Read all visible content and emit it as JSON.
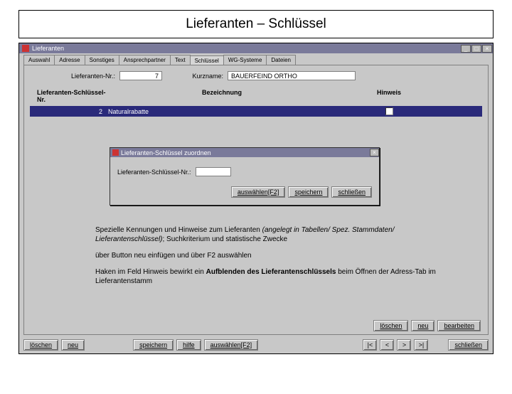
{
  "slide_title": "Lieferanten – Schlüssel",
  "window": {
    "title": "Lieferanten",
    "min": "_",
    "max": "□",
    "close": "×"
  },
  "tabs": [
    "Auswahl",
    "Adresse",
    "Sonstiges",
    "Ansprechpartner",
    "Text",
    "Schlüssel",
    "WG-Systeme",
    "Dateien"
  ],
  "header": {
    "lief_nr_label": "Lieferanten-Nr.:",
    "lief_nr_value": "7",
    "kurz_label": "Kurzname:",
    "kurz_value": "BAUERFEIND ORTHO"
  },
  "columns": {
    "c1": "Lieferanten-Schlüssel-Nr.",
    "c2": "Bezeichnung",
    "c3": "Hinweis"
  },
  "row": {
    "nr": "2",
    "bez": "Naturalrabatte",
    "hinweis_checked": true
  },
  "dialog": {
    "title": "Lieferanten-Schlüssel zuordnen",
    "field_label": "Lieferanten-Schlüssel-Nr.:",
    "field_value": "",
    "btn_auswaehlen": "auswählen[F2]",
    "btn_speichern": "speichern",
    "btn_schliessen": "schließen",
    "close": "×"
  },
  "info": {
    "p1a": "Spezielle Kennungen und Hinweise zum Lieferanten ",
    "p1b": "(angelegt in Tabellen/ Spez. Stammdaten/ Lieferantenschlüssel)",
    "p1c": "; Suchkriterium und statistische Zwecke",
    "p2": "über Button neu einfügen und über F2 auswählen",
    "p3a": "Haken im Feld Hinweis bewirkt ein ",
    "p3b": "Aufblenden des Lieferantenschlüssels",
    "p3c": " beim Öffnen der Adress-Tab im Lieferantenstamm"
  },
  "lower_buttons": {
    "loeschen": "löschen",
    "neu": "neu",
    "bearbeiten": "bearbeiten"
  },
  "bottom": {
    "loeschen": "löschen",
    "neu": "neu",
    "speichern": "speichern",
    "hilfe": "hilfe",
    "auswaehlen": "auswählen[F2]",
    "first": "|<",
    "prev": "<",
    "next": ">",
    "last": ">|",
    "schliessen": "schließen"
  }
}
